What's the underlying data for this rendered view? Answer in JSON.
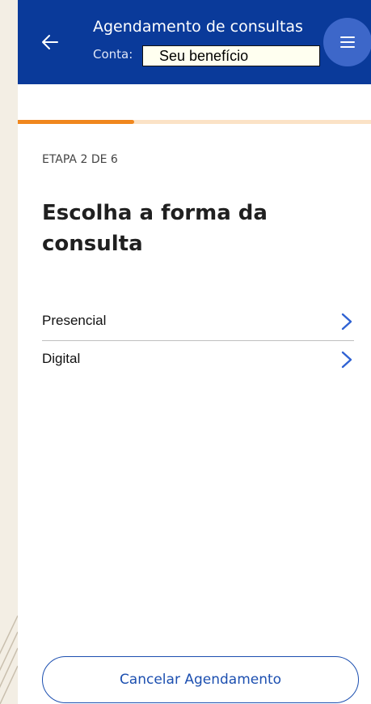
{
  "header": {
    "title": "Agendamento de consultas",
    "account_prefix": "Conta: ",
    "redaction_label": "Seu benefício",
    "back_icon": "arrow-left-icon",
    "menu_icon": "hamburger-menu-icon",
    "background_color": "#0a3a9a"
  },
  "progress": {
    "fraction": 0.33,
    "fill_color": "#f0871e",
    "track_color": "#fbe2c6"
  },
  "main": {
    "step_label": "ETAPA 2 DE 6",
    "heading": "Escolha a forma da consulta",
    "options": [
      {
        "label": "Presencial",
        "icon": "chevron-right-icon"
      },
      {
        "label": "Digital",
        "icon": "chevron-right-icon"
      }
    ]
  },
  "footer": {
    "cancel_label": "Cancelar Agendamento",
    "accent_color": "#1c4fb0"
  }
}
